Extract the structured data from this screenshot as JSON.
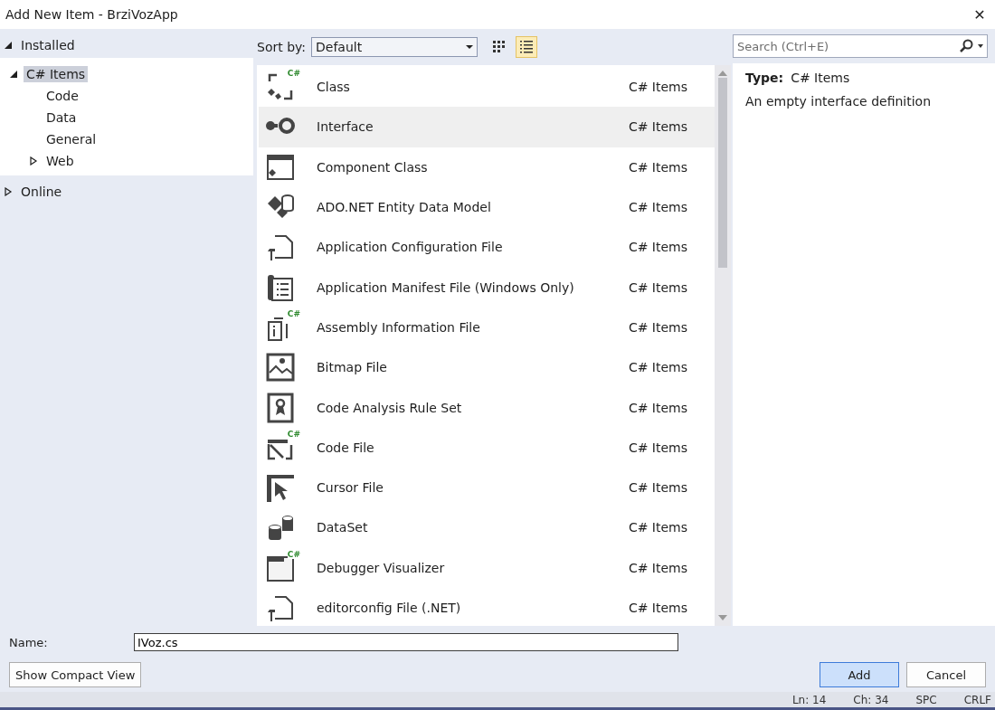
{
  "window": {
    "title": "Add New Item - BrziVozApp",
    "close": "✕"
  },
  "tree": [
    {
      "label": "Installed",
      "expanded": true,
      "selected": false,
      "children": [
        {
          "label": "C# Items",
          "expanded": true,
          "selected": true,
          "children": [
            {
              "label": "Code",
              "selected": false
            },
            {
              "label": "Data",
              "selected": false
            },
            {
              "label": "General",
              "selected": false
            },
            {
              "label": "Web",
              "expanded": false,
              "selected": false
            }
          ]
        }
      ]
    },
    {
      "label": "Online",
      "expanded": false,
      "selected": false
    }
  ],
  "toolbar": {
    "sort_label": "Sort by:",
    "sort_value": "Default",
    "views": [
      {
        "kind": "grid",
        "selected": false
      },
      {
        "kind": "list",
        "selected": true
      }
    ]
  },
  "search": {
    "placeholder": "Search (Ctrl+E)"
  },
  "items": [
    {
      "name": "Class",
      "category": "C# Items",
      "badge": "C#",
      "selected": false
    },
    {
      "name": "Interface",
      "category": "C# Items",
      "selected": true
    },
    {
      "name": "Component Class",
      "category": "C# Items",
      "selected": false
    },
    {
      "name": "ADO.NET Entity Data Model",
      "category": "C# Items",
      "selected": false
    },
    {
      "name": "Application Configuration File",
      "category": "C# Items",
      "selected": false
    },
    {
      "name": "Application Manifest File (Windows Only)",
      "category": "C# Items",
      "selected": false
    },
    {
      "name": "Assembly Information File",
      "category": "C# Items",
      "badge": "C#",
      "selected": false
    },
    {
      "name": "Bitmap File",
      "category": "C# Items",
      "selected": false
    },
    {
      "name": "Code Analysis Rule Set",
      "category": "C# Items",
      "selected": false
    },
    {
      "name": "Code File",
      "category": "C# Items",
      "badge": "C#",
      "selected": false
    },
    {
      "name": "Cursor File",
      "category": "C# Items",
      "selected": false
    },
    {
      "name": "DataSet",
      "category": "C# Items",
      "selected": false
    },
    {
      "name": "Debugger Visualizer",
      "category": "C# Items",
      "badge": "C#",
      "selected": false
    },
    {
      "name": "editorconfig File (.NET)",
      "category": "C# Items",
      "selected": false
    }
  ],
  "details": {
    "type_label": "Type:",
    "type_value": "C# Items",
    "description": "An empty interface definition"
  },
  "name_field": {
    "label": "Name:",
    "value": "IVoz.cs"
  },
  "buttons": [
    {
      "label": "Show Compact View",
      "kind": "plain"
    },
    {
      "label": "Add",
      "kind": "default"
    },
    {
      "label": "Cancel",
      "kind": "plain"
    }
  ],
  "status_bar": [
    "Ln: 14",
    "Ch: 34",
    "SPC",
    "CRLF"
  ]
}
